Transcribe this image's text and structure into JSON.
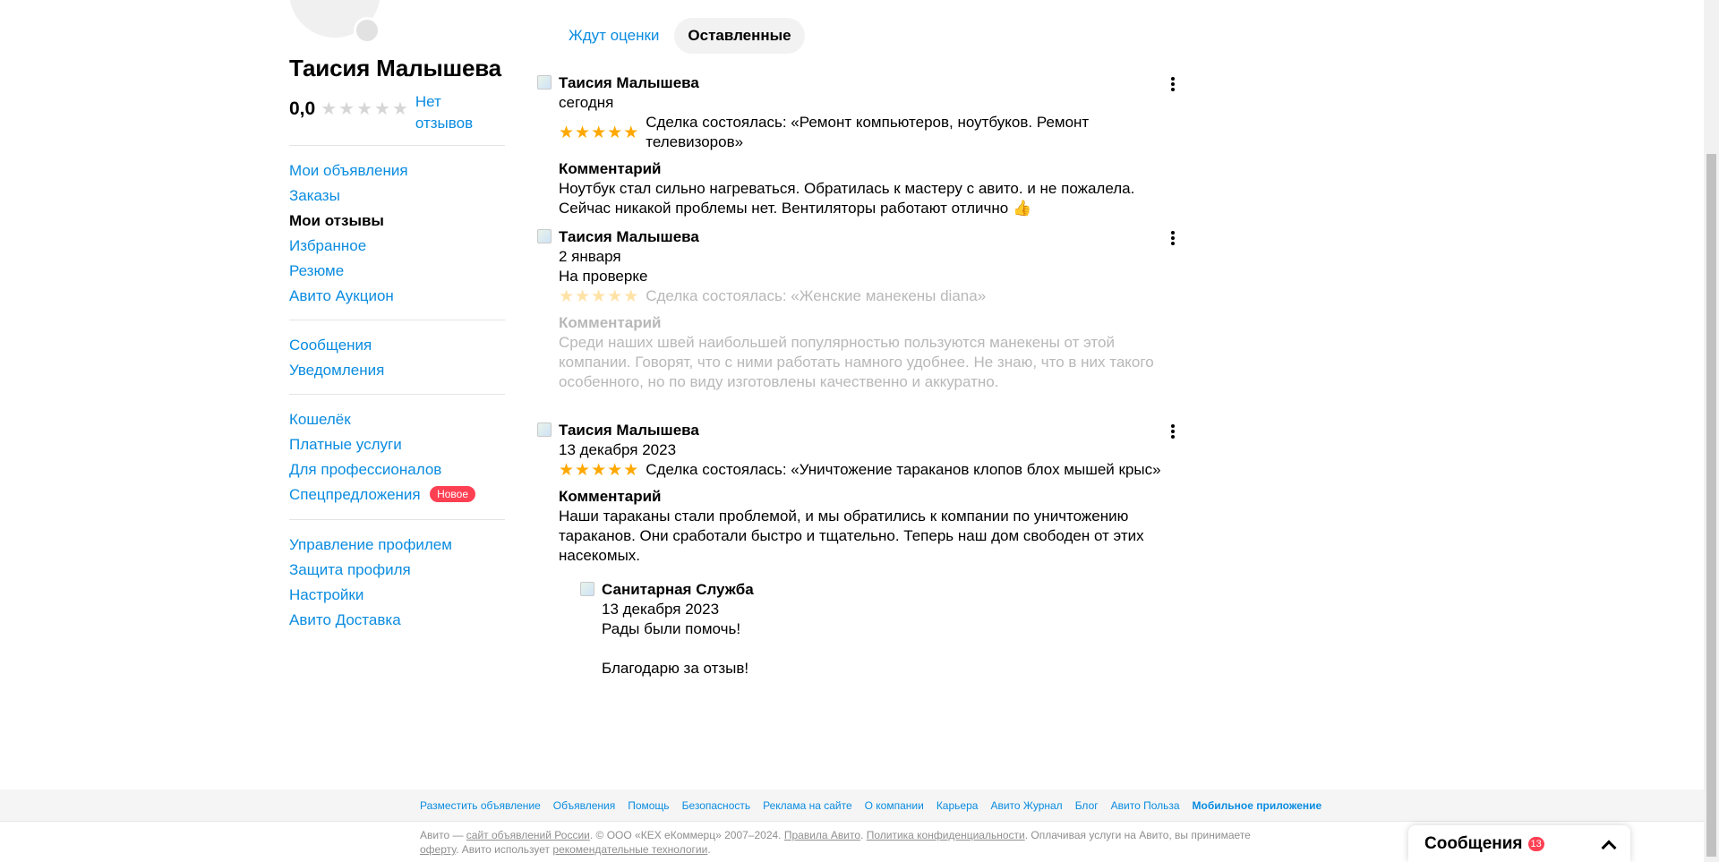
{
  "profile": {
    "name": "Таисия Малышева",
    "rating": "0,0",
    "stars": [
      "★",
      "★",
      "★",
      "★",
      "★"
    ],
    "no_reviews": "Нет отзывов"
  },
  "sidebar": {
    "group1": [
      "Мои объявления",
      "Заказы",
      "Мои отзывы",
      "Избранное",
      "Резюме",
      "Авито Аукцион"
    ],
    "group2": [
      "Сообщения",
      "Уведомления"
    ],
    "group3": [
      "Кошелёк",
      "Платные услуги",
      "Для профессионалов",
      "Спецпредложения"
    ],
    "new_badge": "Новое",
    "group4": [
      "Управление профилем",
      "Защита профиля",
      "Настройки",
      "Авито Доставка"
    ]
  },
  "tabs": {
    "pending": "Ждут оценки",
    "left": "Оставленные"
  },
  "reviews": [
    {
      "author": "Таисия Малышева",
      "date": "сегодня",
      "deal": "Сделка состоялась: «Ремонт компьютеров, ноутбуков. Ремонт телевизоров»",
      "comment_heading": "Комментарий",
      "comment": "Ноутбук стал сильно нагреваться. Обратилась к мастеру с авито. и не пожалела. Сейчас никакой проблемы нет. Вентиляторы работают отлично 👍"
    },
    {
      "author": "Таисия Малышева",
      "date": "2 января",
      "status": "На проверке",
      "deal": "Сделка состоялась: «Женские манекены diana»",
      "comment_heading": "Комментарий",
      "comment": "Среди наших швей наибольшей популярностью пользуются манекены от этой компании. Говорят, что с ними работать намного удобнее. Не знаю, что в них такого особенного, но по виду изготовлены качественно и аккуратно."
    },
    {
      "author": "Таисия Малышева",
      "date": "13 декабря 2023",
      "deal": "Сделка состоялась: «Уничтожение тараканов клопов блох мышей крыс»",
      "comment_heading": "Комментарий",
      "comment": "Наши тараканы стали проблемой, и мы обратились к компании по уничтожению тараканов. Они сработали быстро и тщательно. Теперь наш дом свободен от этих насекомых.",
      "reply": {
        "author": "Санитарная Служба",
        "date": "13 декабря 2023",
        "line1": "Рады были помочь!",
        "line2": "Благодарю за отзыв!"
      }
    }
  ],
  "review_stars": [
    "★",
    "★",
    "★",
    "★",
    "★"
  ],
  "footer": {
    "links": [
      "Разместить объявление",
      "Объявления",
      "Помощь",
      "Безопасность",
      "Реклама на сайте",
      "О компании",
      "Карьера",
      "Авито Журнал",
      "Блог",
      "Авито Польза",
      "Мобильное приложение"
    ],
    "legal_prefix": "Авито — ",
    "legal_link1": "сайт объявлений России",
    "legal_mid1": ". © ООО «КЕХ еКоммерц» 2007–2024. ",
    "legal_link2": "Правила Авито",
    "legal_mid2": ". ",
    "legal_link3": "Политика конфиденциальности",
    "legal_mid3": ". Оплачивая услуги на Авито, вы принимаете ",
    "legal_link4": "оферту",
    "legal_mid4": ". Авито использует ",
    "legal_link5": "рекомендательные технологии",
    "legal_end": "."
  },
  "messenger": {
    "title": "Сообщения",
    "count": "13"
  },
  "colors": {
    "link": "#0a8ce0",
    "star": "#ffa800",
    "badge": "#ff4053"
  }
}
